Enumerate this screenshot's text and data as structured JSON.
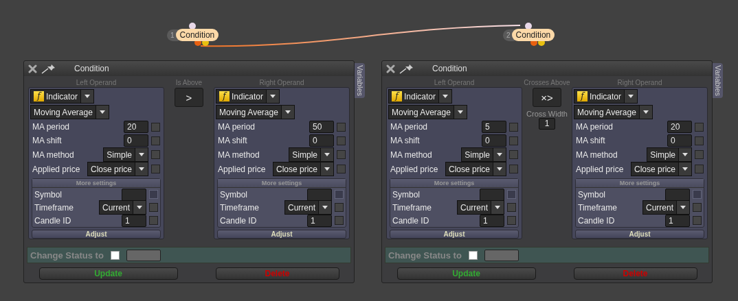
{
  "nodes": [
    {
      "number": "1",
      "label": "Condition"
    },
    {
      "number": "2",
      "label": "Condition"
    }
  ],
  "panels": [
    {
      "title": "Condition",
      "side_tab": "Variables",
      "operands": [
        {
          "header": "Left Operand",
          "type_icon": "f",
          "type": "Indicator",
          "indicator": "Moving Average",
          "params": [
            {
              "kind": "number",
              "label": "MA period",
              "value": "20",
              "checked": false
            },
            {
              "kind": "number",
              "label": "MA shift",
              "value": "0",
              "checked": false
            },
            {
              "kind": "select",
              "label": "MA method",
              "value": "Simple",
              "checked": false
            },
            {
              "kind": "select",
              "label": "Applied price",
              "value": "Close price",
              "checked": false
            }
          ],
          "more_title": "More settings",
          "more": [
            {
              "kind": "number",
              "label": "Symbol",
              "checked": false,
              "disabled": true
            },
            {
              "kind": "select",
              "label": "Timeframe",
              "value": "Current",
              "checked": false,
              "disabled": false
            },
            {
              "kind": "number",
              "label": "Candle ID",
              "value": "1",
              "checked": false,
              "disabled": false
            }
          ],
          "adjust": "Adjust"
        },
        {
          "header": "Right Operand",
          "type_icon": "f",
          "type": "Indicator",
          "indicator": "Moving Average",
          "params": [
            {
              "kind": "number",
              "label": "MA period",
              "value": "50",
              "checked": false
            },
            {
              "kind": "number",
              "label": "MA shift",
              "value": "0",
              "checked": false
            },
            {
              "kind": "select",
              "label": "MA method",
              "value": "Simple",
              "checked": false
            },
            {
              "kind": "select",
              "label": "Applied price",
              "value": "Close price",
              "checked": false
            }
          ],
          "more_title": "More settings",
          "more": [
            {
              "kind": "number",
              "label": "Symbol",
              "checked": false,
              "disabled": true
            },
            {
              "kind": "select",
              "label": "Timeframe",
              "value": "Current",
              "checked": false,
              "disabled": false
            },
            {
              "kind": "number",
              "label": "Candle ID",
              "value": "1",
              "checked": false,
              "disabled": false
            }
          ],
          "adjust": "Adjust"
        }
      ],
      "operator": {
        "label": "Is Above",
        "symbol": ">"
      },
      "status": {
        "label": "Change Status to",
        "checked": false
      },
      "update": "Update",
      "delete": "Delete"
    },
    {
      "title": "Condition",
      "side_tab": "Variables",
      "operands": [
        {
          "header": "Left Operand",
          "type_icon": "f",
          "type": "Indicator",
          "indicator": "Moving Average",
          "params": [
            {
              "kind": "number",
              "label": "MA period",
              "value": "5",
              "checked": false
            },
            {
              "kind": "number",
              "label": "MA shift",
              "value": "0",
              "checked": false
            },
            {
              "kind": "select",
              "label": "MA method",
              "value": "Simple",
              "checked": false
            },
            {
              "kind": "select",
              "label": "Applied price",
              "value": "Close price",
              "checked": false
            }
          ],
          "more_title": "More settings",
          "more": [
            {
              "kind": "number",
              "label": "Symbol",
              "checked": false,
              "disabled": true
            },
            {
              "kind": "select",
              "label": "Timeframe",
              "value": "Current",
              "checked": false,
              "disabled": false
            },
            {
              "kind": "number",
              "label": "Candle ID",
              "value": "1",
              "checked": false,
              "disabled": false
            }
          ],
          "adjust": "Adjust"
        },
        {
          "header": "Right Operand",
          "type_icon": "f",
          "type": "Indicator",
          "indicator": "Moving Average",
          "params": [
            {
              "kind": "number",
              "label": "MA period",
              "value": "20",
              "checked": false
            },
            {
              "kind": "number",
              "label": "MA shift",
              "value": "0",
              "checked": false
            },
            {
              "kind": "select",
              "label": "MA method",
              "value": "Simple",
              "checked": false
            },
            {
              "kind": "select",
              "label": "Applied price",
              "value": "Close price",
              "checked": false
            }
          ],
          "more_title": "More settings",
          "more": [
            {
              "kind": "number",
              "label": "Symbol",
              "checked": false,
              "disabled": true
            },
            {
              "kind": "select",
              "label": "Timeframe",
              "value": "Current",
              "checked": false,
              "disabled": false
            },
            {
              "kind": "number",
              "label": "Candle ID",
              "value": "1",
              "checked": false,
              "disabled": false
            }
          ],
          "adjust": "Adjust"
        }
      ],
      "operator": {
        "label": "Crosses Above",
        "symbol": "×>",
        "cross_label": "Cross Width",
        "cross_value": "1"
      },
      "status": {
        "label": "Change Status to",
        "checked": false
      },
      "update": "Update",
      "delete": "Delete"
    }
  ]
}
